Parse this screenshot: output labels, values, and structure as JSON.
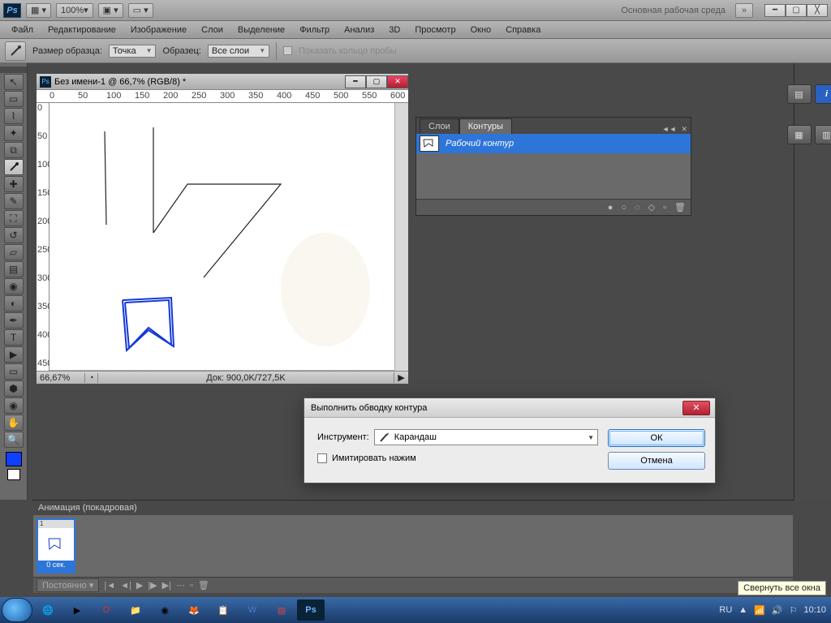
{
  "appbar": {
    "logo": "Ps",
    "zoom": "100%",
    "workspace_label": "Основная рабочая среда",
    "workspace_chevrons": "»"
  },
  "menubar": [
    "Файл",
    "Редактирование",
    "Изображение",
    "Слои",
    "Выделение",
    "Фильтр",
    "Анализ",
    "3D",
    "Просмотр",
    "Окно",
    "Справка"
  ],
  "optbar": {
    "label_size": "Размер образца:",
    "size_value": "Точка",
    "label_sample": "Образец:",
    "sample_value": "Все слои",
    "ring_label": "Показать кольцо пробы"
  },
  "doc": {
    "title": "Без имени-1 @ 66,7% (RGB/8) *",
    "ruler_marks": [
      "0",
      "50",
      "100",
      "150",
      "200",
      "250",
      "300",
      "350",
      "400",
      "450",
      "500",
      "550",
      "600"
    ],
    "vruler_marks": [
      "0",
      "50",
      "100",
      "150",
      "200",
      "250",
      "300",
      "350",
      "400",
      "450"
    ],
    "zoom": "66,67%",
    "docinfo": "Док: 900,0K/727,5K"
  },
  "paths_panel": {
    "tab_layers": "Слои",
    "tab_paths": "Контуры",
    "work_path": "Рабочий контур"
  },
  "dialog": {
    "title": "Выполнить обводку контура",
    "tool_label": "Инструмент:",
    "tool_value": "Карандаш",
    "simulate_label": "Имитировать нажим",
    "ok": "ОК",
    "cancel": "Отмена"
  },
  "animation": {
    "title": "Анимация (покадровая)",
    "frame_num": "1",
    "frame_time": "0 сек.",
    "loop": "Постоянно"
  },
  "tooltip": "Свернуть все окна",
  "tray": {
    "lang": "RU",
    "time": "10:10"
  },
  "right_info": "i"
}
